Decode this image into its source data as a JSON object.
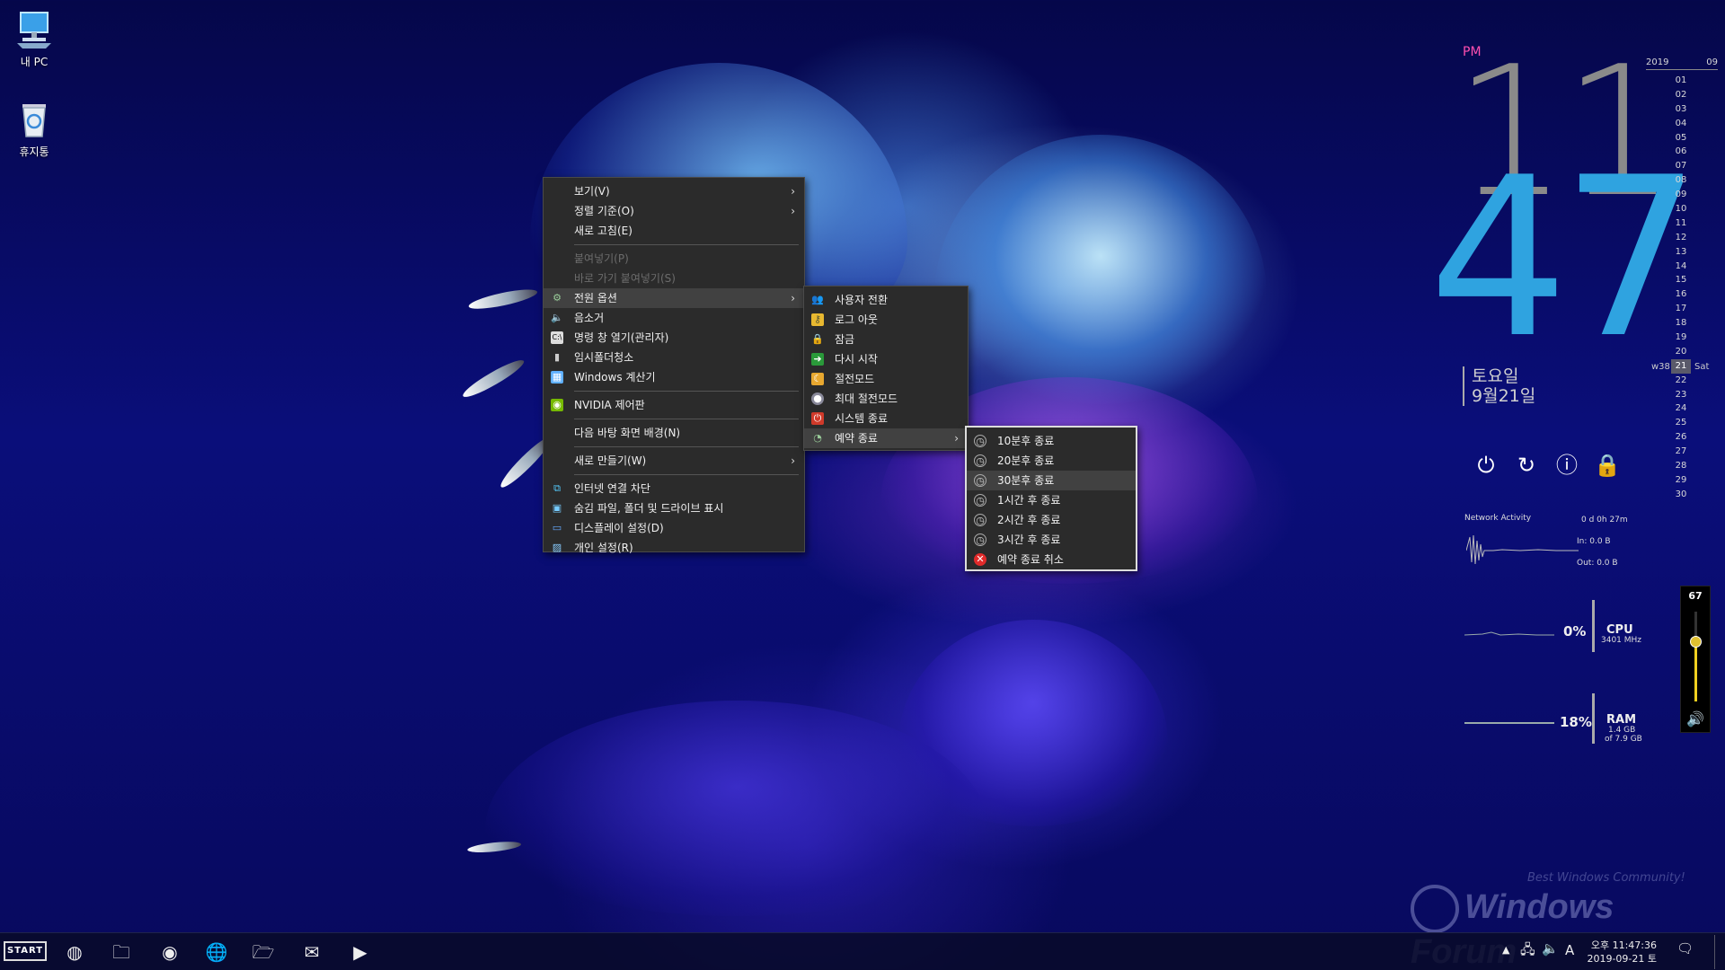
{
  "desktop": {
    "icons": [
      {
        "label": "내 PC",
        "icon": "computer-icon"
      },
      {
        "label": "휴지통",
        "icon": "recycle-bin-icon"
      }
    ]
  },
  "context_menu": {
    "items": [
      {
        "label": "보기(V)",
        "submenu": true
      },
      {
        "label": "정렬 기준(O)",
        "submenu": true
      },
      {
        "label": "새로 고침(E)"
      },
      {
        "label": "붙여넣기(P)",
        "disabled": true
      },
      {
        "label": "바로 가기 붙여넣기(S)",
        "disabled": true
      },
      {
        "label": "전원 옵션",
        "submenu": true,
        "icon": "power-options-icon"
      },
      {
        "label": "음소거",
        "icon": "speaker-icon"
      },
      {
        "label": "명령 창 열기(관리자)",
        "icon": "terminal-icon"
      },
      {
        "label": "임시폴더청소",
        "icon": "trash-icon"
      },
      {
        "label": "Windows 계산기",
        "icon": "calculator-icon"
      },
      {
        "label": "NVIDIA 제어판",
        "icon": "nvidia-icon"
      },
      {
        "label": "다음 바탕 화면 배경(N)"
      },
      {
        "label": "새로 만들기(W)",
        "submenu": true
      },
      {
        "label": "인터넷 연결 차단",
        "icon": "network-icon"
      },
      {
        "label": "숨김 파일, 폴더 및 드라이브 표시",
        "icon": "hidden-files-icon"
      },
      {
        "label": "디스플레이 설정(D)",
        "icon": "display-icon"
      },
      {
        "label": "개인 설정(R)",
        "icon": "personalize-icon"
      }
    ]
  },
  "power_submenu": {
    "items": [
      {
        "label": "사용자 전환",
        "icon": "switch-user-icon"
      },
      {
        "label": "로그 아웃",
        "icon": "logout-key-icon"
      },
      {
        "label": "잠금",
        "icon": "lock-icon"
      },
      {
        "label": "다시 시작",
        "icon": "restart-arrow-icon"
      },
      {
        "label": "절전모드",
        "icon": "sleep-icon"
      },
      {
        "label": "최대 절전모드",
        "icon": "hibernate-icon"
      },
      {
        "label": "시스템 종료",
        "icon": "shutdown-icon"
      },
      {
        "label": "예약 종료",
        "icon": "scheduled-shutdown-icon",
        "submenu": true
      }
    ]
  },
  "schedule_submenu": {
    "items": [
      {
        "label": "10분후 종료",
        "icon": "timer-icon"
      },
      {
        "label": "20분후 종료",
        "icon": "timer-icon"
      },
      {
        "label": "30분후 종료",
        "icon": "timer-icon"
      },
      {
        "label": "1시간 후 종료",
        "icon": "timer-icon"
      },
      {
        "label": "2시간 후 종료",
        "icon": "timer-icon"
      },
      {
        "label": "3시간 후 종료",
        "icon": "timer-icon"
      },
      {
        "label": "예약 종료 취소",
        "icon": "cancel-icon"
      }
    ]
  },
  "clock_widget": {
    "ampm": "PM",
    "hour": "11",
    "minute": "47",
    "weekday": "토요일",
    "date": "9월21일"
  },
  "calendar": {
    "year": "2019",
    "month": "09",
    "days": [
      "01",
      "02",
      "03",
      "04",
      "05",
      "06",
      "07",
      "08",
      "09",
      "10",
      "11",
      "12",
      "13",
      "14",
      "15",
      "16",
      "17",
      "18",
      "19",
      "20",
      "21",
      "22",
      "23",
      "24",
      "25",
      "26",
      "27",
      "28",
      "29",
      "30"
    ],
    "today": "21",
    "week": "w38",
    "weekday_short": "Sat"
  },
  "system": {
    "network_label": "Network Activity",
    "uptime": "0 d 0h 27m",
    "net_in": "In: 0.0 B",
    "net_out": "Out: 0.0 B",
    "cpu_pct": "0%",
    "cpu_label": "CPU",
    "cpu_freq": "3401 MHz",
    "ram_pct": "18%",
    "ram_label": "RAM",
    "ram_used": "1.4 GB",
    "ram_total": "of 7.9 GB",
    "volume": "67",
    "volume_level": 0.67
  },
  "taskbar": {
    "start_label": "START",
    "ime": "A",
    "time": "오후 11:47:36",
    "date": "2019-09-21 토"
  },
  "watermark": {
    "text": "Windows Forum",
    "sub": "Best Windows Community!"
  }
}
